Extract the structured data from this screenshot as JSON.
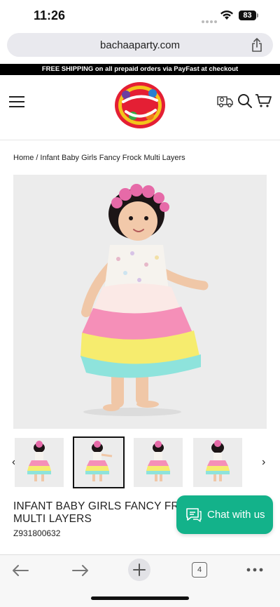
{
  "status": {
    "time": "11:26",
    "battery": "83"
  },
  "browser": {
    "url": "bachaaparty.com",
    "tab_count": "4"
  },
  "announcement": "FREE SHIPPING on all prepaid orders via PayFast at checkout",
  "logo": {
    "alt": "Bachaa Party"
  },
  "breadcrumb": {
    "home": "Home",
    "separator": "/",
    "current": "Infant Baby Girls Fancy Frock Multi Layers"
  },
  "product": {
    "title": "INFANT BABY GIRLS FANCY FROCK MULTI LAYERS",
    "sku": "Z931800632",
    "thumbnails": [
      "front",
      "wave",
      "side",
      "back"
    ]
  },
  "chat": {
    "label": "Chat with us"
  },
  "colors": {
    "chat_green": "#13b28a",
    "announcement_bg": "#000000"
  },
  "icons": [
    "menu-icon",
    "delivery-truck-icon",
    "search-icon",
    "cart-icon",
    "share-icon",
    "back-icon",
    "forward-icon",
    "new-tab-icon",
    "tabs-icon",
    "more-icon",
    "chat-icon"
  ]
}
